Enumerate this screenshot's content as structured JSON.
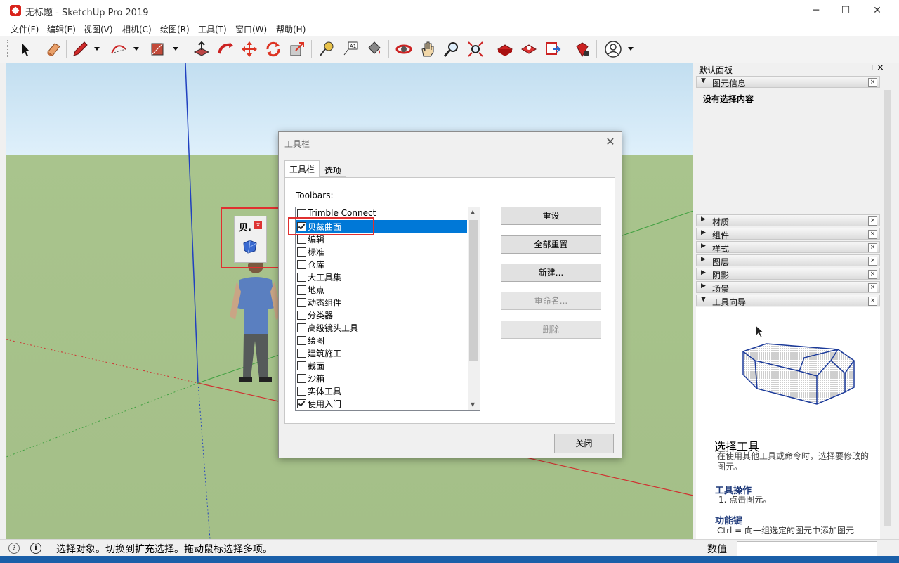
{
  "window": {
    "title": "无标题 - SketchUp Pro 2019",
    "minimize_glyph": "─",
    "maximize_glyph": "☐",
    "close_glyph": "✕"
  },
  "menu": [
    "文件(F)",
    "编辑(E)",
    "视图(V)",
    "相机(C)",
    "绘图(R)",
    "工具(T)",
    "窗口(W)",
    "帮助(H)"
  ],
  "toolbar_icons": [
    "select-icon",
    "eraser-icon",
    "pencil-icon",
    "arc-icon",
    "rectangle-icon",
    "push-pull-icon",
    "follow-me-icon",
    "move-icon",
    "rotate-icon",
    "scale-icon",
    "tape-measure-icon",
    "text-icon",
    "paint-bucket-icon",
    "orbit-icon",
    "pan-icon",
    "zoom-icon",
    "zoom-extents-icon",
    "3d-warehouse-icon",
    "extension-warehouse-icon",
    "layout-icon",
    "extension-manager-icon",
    "account-icon"
  ],
  "dialog": {
    "title": "工具栏",
    "close_glyph": "✕",
    "tabs": [
      "工具栏",
      "选项"
    ],
    "list_label": "Toolbars:",
    "toolbars": [
      {
        "label": "Trimble Connect",
        "checked": false
      },
      {
        "label": "贝兹曲面",
        "checked": true,
        "selected": true
      },
      {
        "label": "编辑",
        "checked": false
      },
      {
        "label": "标准",
        "checked": false
      },
      {
        "label": "仓库",
        "checked": false
      },
      {
        "label": "大工具集",
        "checked": false
      },
      {
        "label": "地点",
        "checked": false
      },
      {
        "label": "动态组件",
        "checked": false
      },
      {
        "label": "分类器",
        "checked": false
      },
      {
        "label": "高级镜头工具",
        "checked": false
      },
      {
        "label": "绘图",
        "checked": false
      },
      {
        "label": "建筑施工",
        "checked": false
      },
      {
        "label": "截面",
        "checked": false
      },
      {
        "label": "沙箱",
        "checked": false
      },
      {
        "label": "实体工具",
        "checked": false
      },
      {
        "label": "使用入门",
        "checked": true
      }
    ],
    "buttons": {
      "reset": "重设",
      "reset_all": "全部重置",
      "new": "新建...",
      "rename": "重命名...",
      "delete": "删除",
      "close": "关闭"
    }
  },
  "mini_toolbar": {
    "title": "贝.",
    "close_glyph": "x"
  },
  "panel": {
    "title": "默认面板",
    "pin_glyph": "ꟷ",
    "close_glyph": "×",
    "entity_info": {
      "label": "图元信息",
      "content": "没有选择内容"
    },
    "sections": [
      "材质",
      "组件",
      "样式",
      "图层",
      "阴影",
      "场景"
    ],
    "instructor": {
      "label": "工具向导",
      "tool_title": "选择工具",
      "tool_desc": "在使用其他工具或命令时，选择要修改的图元。",
      "ops_title": "工具操作",
      "ops_item": "1. 点击图元。",
      "keys_title": "功能键",
      "keys_item": "Ctrl = 向一组选定的图元中添加图元"
    }
  },
  "status": {
    "message": "选择对象。切换到扩充选择。拖动鼠标选择多项。",
    "value_label": "数值"
  },
  "colors": {
    "sky": "#c2def0",
    "ground": "#a9c48d",
    "selection": "#0078d7",
    "highlight": "#e03030"
  }
}
